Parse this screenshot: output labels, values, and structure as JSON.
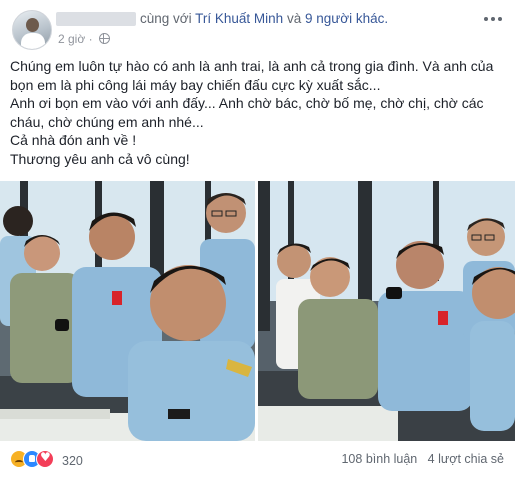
{
  "post": {
    "author_suffix": "cùng với",
    "tagged_person": "Trí Khuất Minh",
    "conjunction": "và",
    "others": "9 người khác.",
    "timestamp": "2 giờ",
    "lines": [
      "Chúng em luôn tự hào có anh là anh trai, là anh cả trong gia đình. Và anh của",
      "bọn em là phi công lái máy bay chiến đấu cực kỳ xuất sắc...",
      "Anh ơi bọn em vào với anh đấy... Anh chờ bác, chờ bố mẹ, chờ chị, chờ các",
      "cháu, chờ chúng em anh nhé...",
      "Cả nhà đón anh về !",
      "Thương yêu anh cả vô cùng!"
    ]
  },
  "footer": {
    "reaction_count": "320",
    "comments": "108 bình luận",
    "shares": "4 lượt chia sẻ"
  },
  "icons": {
    "privacy": "globe-icon",
    "more": "more-options-icon",
    "reactions": [
      "sad-reaction-icon",
      "like-reaction-icon",
      "love-reaction-icon"
    ]
  },
  "colors": {
    "link": "#385898",
    "meta": "#90949c",
    "uniform": "#8fb9d9"
  }
}
